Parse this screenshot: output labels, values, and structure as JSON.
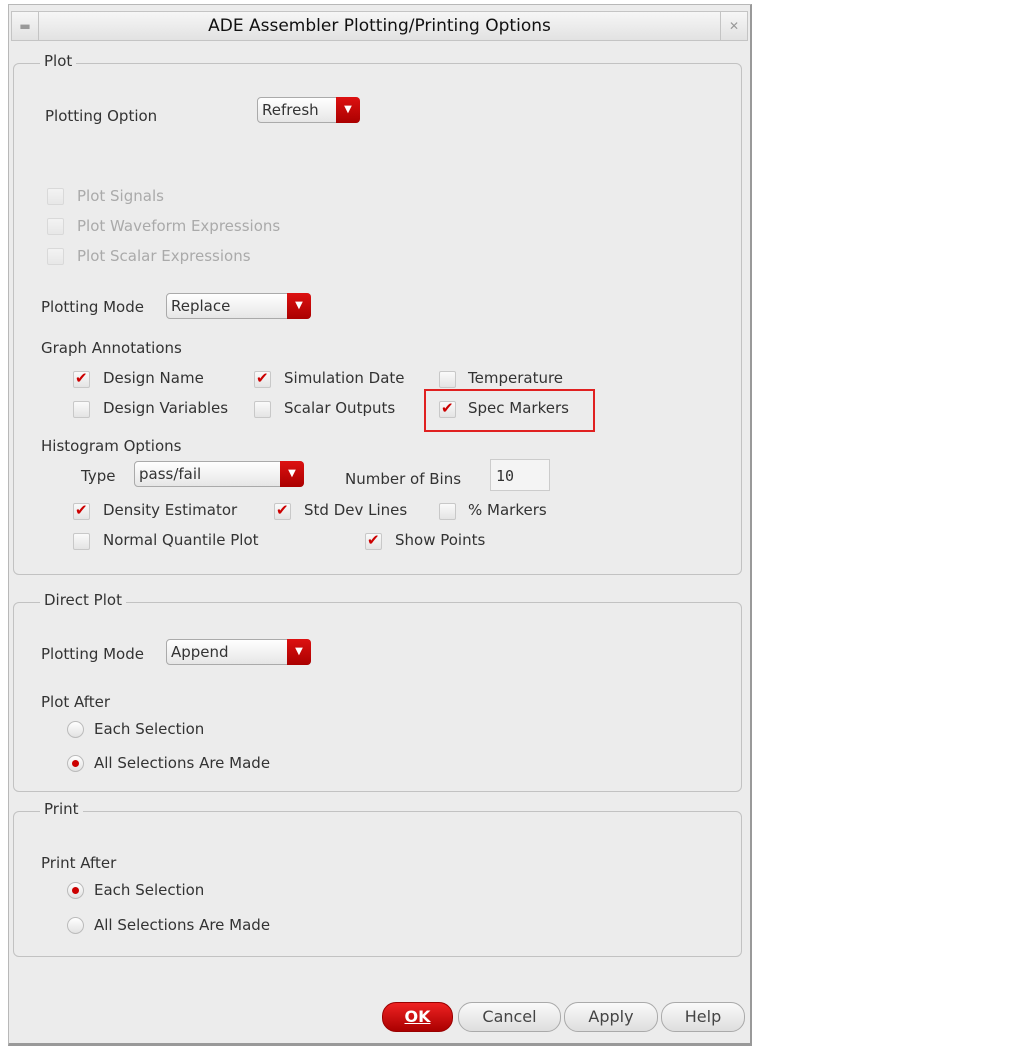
{
  "title": "ADE Assembler Plotting/Printing Options",
  "plot": {
    "label": "Plot",
    "plotting_option_label": "Plotting Option",
    "plotting_option": "Refresh",
    "disabled_checks": [
      {
        "label": "Plot Signals"
      },
      {
        "label": "Plot Waveform Expressions"
      },
      {
        "label": "Plot Scalar Expressions"
      }
    ],
    "plotting_mode_label": "Plotting Mode",
    "plotting_mode": "Replace",
    "graph_annotations_label": "Graph Annotations",
    "annotations": [
      {
        "label": "Design Name",
        "checked": true
      },
      {
        "label": "Simulation Date",
        "checked": true
      },
      {
        "label": "Temperature",
        "checked": false
      },
      {
        "label": "Design Variables",
        "checked": false
      },
      {
        "label": "Scalar Outputs",
        "checked": false
      },
      {
        "label": "Spec Markers",
        "checked": true
      }
    ],
    "histogram_label": "Histogram Options",
    "type_label": "Type",
    "type": "pass/fail",
    "bins_label": "Number of Bins",
    "bins": "10",
    "hist_checks": [
      {
        "label": "Density Estimator",
        "checked": true
      },
      {
        "label": "Std Dev Lines",
        "checked": true
      },
      {
        "label": "% Markers",
        "checked": false
      },
      {
        "label": "Normal Quantile Plot",
        "checked": false
      },
      {
        "label": "Show Points",
        "checked": true
      }
    ]
  },
  "direct": {
    "label": "Direct Plot",
    "plotting_mode_label": "Plotting Mode",
    "plotting_mode": "Append",
    "plot_after_label": "Plot After",
    "options": [
      {
        "label": "Each Selection",
        "selected": false
      },
      {
        "label": "All Selections Are Made",
        "selected": true
      }
    ]
  },
  "print": {
    "label": "Print",
    "print_after_label": "Print After",
    "options": [
      {
        "label": "Each Selection",
        "selected": true
      },
      {
        "label": "All Selections Are Made",
        "selected": false
      }
    ]
  },
  "buttons": {
    "ok": "OK",
    "cancel": "Cancel",
    "apply": "Apply",
    "help": "Help"
  },
  "highlight_color": "#e02020"
}
